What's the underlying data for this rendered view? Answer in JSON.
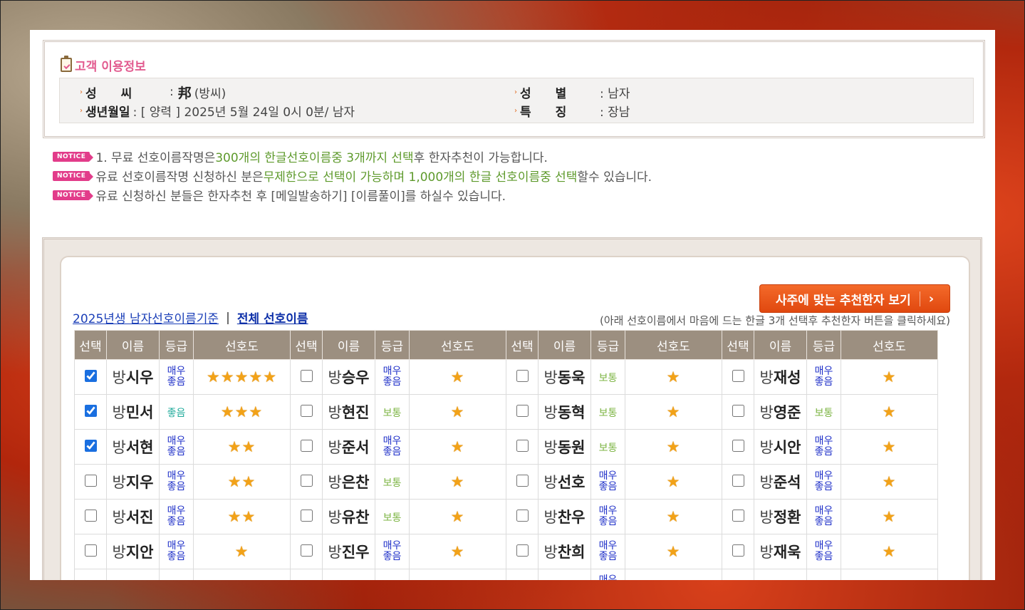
{
  "info": {
    "title": "고객 이용정보",
    "surname_label": "성　　씨",
    "surname_hanja": "邦",
    "surname_reading": "(방씨)",
    "gender_label": "성　　별",
    "gender_value": ": 남자",
    "birth_label": "생년월일",
    "birth_value": ": [ 양력 ] 2025년 5월 24일 0시 0분/ 남자",
    "feature_label": "특　　징",
    "feature_value": ": 장남"
  },
  "notices": {
    "badge": "NOTICE",
    "n1_a": "1. 무료 선호이름작명은 ",
    "n1_b": "300개의 한글선호이름중 3개까지 선택",
    "n1_c": "후 한자추천이 가능합니다.",
    "n2_a": "유료 선호이름작명 신청하신 분은",
    "n2_b": "무제한으로 선택이 가능하며 1,000개의 한글 선호이름중 선택",
    "n2_c": "할수 있습니다.",
    "n3": "유료 신청하신 분들은 한자추천 후 [메일발송하기] [이름풀이]를 하실수 있습니다."
  },
  "recommend_button": "사주에 맞는 추천한자 보기",
  "tabs": {
    "basis": "2025년생 남자선호이름기준",
    "separator": "|",
    "all": "전체 선호이름"
  },
  "hint": "(아래 선호이름에서 마음에 드는 한글 3개 선택후 추천한자 버튼을 클릭하세요)",
  "table": {
    "headers": [
      "선택",
      "이름",
      "등급",
      "선호도"
    ],
    "surname": "방",
    "grade_labels": {
      "very_good": "매우 좋음",
      "good": "좋음",
      "normal": "보통"
    },
    "rows": [
      [
        {
          "given": "시우",
          "checked": true,
          "grade": "매우 좋음",
          "stars": 5
        },
        {
          "given": "승우",
          "checked": false,
          "grade": "매우 좋음",
          "stars": 1
        },
        {
          "given": "동욱",
          "checked": false,
          "grade": "보통",
          "stars": 1
        },
        {
          "given": "재성",
          "checked": false,
          "grade": "매우 좋음",
          "stars": 1
        }
      ],
      [
        {
          "given": "민서",
          "checked": true,
          "grade": "좋음",
          "stars": 3
        },
        {
          "given": "현진",
          "checked": false,
          "grade": "보통",
          "stars": 1
        },
        {
          "given": "동혁",
          "checked": false,
          "grade": "보통",
          "stars": 1
        },
        {
          "given": "영준",
          "checked": false,
          "grade": "보통",
          "stars": 1
        }
      ],
      [
        {
          "given": "서현",
          "checked": true,
          "grade": "매우 좋음",
          "stars": 2
        },
        {
          "given": "준서",
          "checked": false,
          "grade": "매우 좋음",
          "stars": 1
        },
        {
          "given": "동원",
          "checked": false,
          "grade": "보통",
          "stars": 1
        },
        {
          "given": "시안",
          "checked": false,
          "grade": "매우 좋음",
          "stars": 1
        }
      ],
      [
        {
          "given": "지우",
          "checked": false,
          "grade": "매우 좋음",
          "stars": 2
        },
        {
          "given": "은찬",
          "checked": false,
          "grade": "보통",
          "stars": 1
        },
        {
          "given": "선호",
          "checked": false,
          "grade": "매우 좋음",
          "stars": 1
        },
        {
          "given": "준석",
          "checked": false,
          "grade": "매우 좋음",
          "stars": 1
        }
      ],
      [
        {
          "given": "서진",
          "checked": false,
          "grade": "매우 좋음",
          "stars": 2
        },
        {
          "given": "유찬",
          "checked": false,
          "grade": "보통",
          "stars": 1
        },
        {
          "given": "찬우",
          "checked": false,
          "grade": "매우 좋음",
          "stars": 1
        },
        {
          "given": "정환",
          "checked": false,
          "grade": "매우 좋음",
          "stars": 1
        }
      ],
      [
        {
          "given": "지안",
          "checked": false,
          "grade": "매우 좋음",
          "stars": 1
        },
        {
          "given": "진우",
          "checked": false,
          "grade": "매우 좋음",
          "stars": 1
        },
        {
          "given": "찬희",
          "checked": false,
          "grade": "매우 좋음",
          "stars": 1
        },
        {
          "given": "재욱",
          "checked": false,
          "grade": "매우 좋음",
          "stars": 1
        }
      ],
      [
        {
          "given": "",
          "checked": false,
          "grade": "",
          "stars": 0
        },
        {
          "given": "",
          "checked": false,
          "grade": "",
          "stars": 0
        },
        {
          "given": "",
          "checked": false,
          "grade": "매우",
          "stars": 0
        },
        {
          "given": "",
          "checked": false,
          "grade": "",
          "stars": 0
        }
      ]
    ]
  },
  "colors": {
    "accent_orange": "#e0480f",
    "header_bg": "#9c8f80",
    "notice_pink": "#e23c8a",
    "green_text": "#5e9a2c",
    "grade_very_good": "#1e2fc8",
    "grade_good": "#1eaa9a",
    "grade_normal": "#7cb443",
    "star": "#f2a218"
  }
}
